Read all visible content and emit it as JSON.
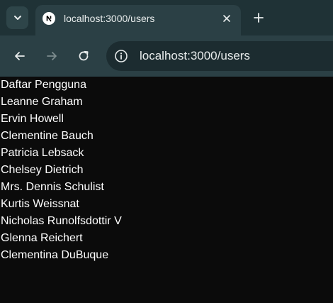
{
  "browser": {
    "tab": {
      "title": "localhost:3000/users"
    },
    "address_bar": {
      "url": "localhost:3000/users"
    }
  },
  "page": {
    "heading": "Daftar Pengguna",
    "users": [
      "Leanne Graham",
      "Ervin Howell",
      "Clementine Bauch",
      "Patricia Lebsack",
      "Chelsey Dietrich",
      "Mrs. Dennis Schulist",
      "Kurtis Weissnat",
      "Nicholas Runolfsdottir V",
      "Glenna Reichert",
      "Clementina DuBuque"
    ]
  },
  "colors": {
    "tabstrip": "#1f3236",
    "toolbar": "#2b4045",
    "omnibox": "#1c2c30",
    "page_background": "#0b0b0b",
    "page_text": "#ffffff"
  }
}
